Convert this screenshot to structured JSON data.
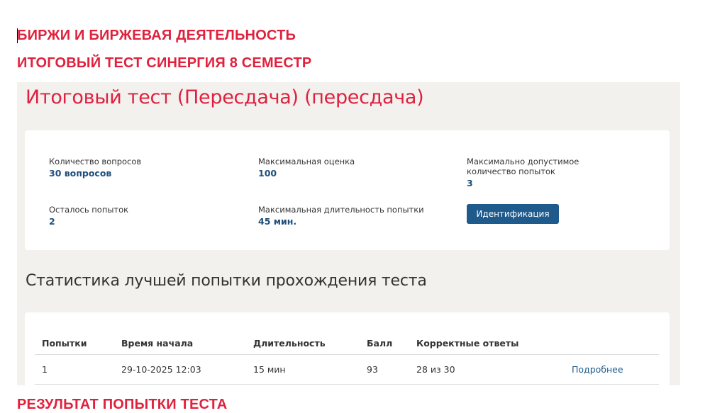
{
  "headings": {
    "line1": "БИРЖИ И БИРЖЕВАЯ ДЕЯТЕЛЬНОСТЬ",
    "line2": "ИТОГОВЫЙ ТЕСТ СИНЕРГИЯ 8 СЕМЕСТР",
    "line3": "РЕЗУЛЬТАТ ПОПЫТКИ ТЕСТА"
  },
  "test": {
    "title": "Итоговый тест (Пересдача) (пересдача)",
    "fields": {
      "questions_label": "Количество вопросов",
      "questions_value": "30 вопросов",
      "max_score_label": "Максимальная оценка",
      "max_score_value": "100",
      "max_attempts_label": "Максимально допустимое количество попыток",
      "max_attempts_value": "3",
      "attempts_left_label": "Осталось попыток",
      "attempts_left_value": "2",
      "max_duration_label": "Максимальная длительность попытки",
      "max_duration_value": "45 мин."
    },
    "identify_button": "Идентификация"
  },
  "stats": {
    "title": "Статистика лучшей попытки прохождения теста",
    "columns": [
      "Попытки",
      "Время начала",
      "Длительность",
      "Балл",
      "Корректные ответы",
      ""
    ],
    "rows": [
      {
        "attempt": "1",
        "start_time": "29-10-2025 12:03",
        "duration": "15 мин",
        "score": "93",
        "correct": "28 из 30",
        "details_link": "Подробнее"
      }
    ]
  },
  "colors": {
    "accent_red": "#e0213d",
    "link_blue": "#1d5a8c",
    "button_blue": "#1e5a8c",
    "panel_bg": "#f2f1ed"
  }
}
